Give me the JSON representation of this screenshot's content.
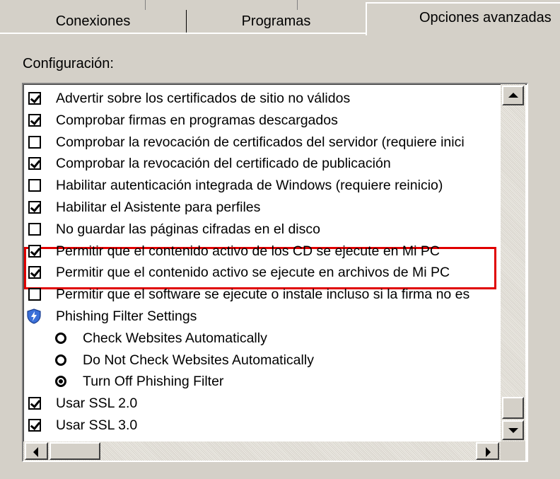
{
  "tabs": [
    {
      "label": "Conexiones",
      "active": false
    },
    {
      "label": "Programas",
      "active": false
    },
    {
      "label": "Opciones avanzadas",
      "active": true
    }
  ],
  "config_label": "Configuración:",
  "items": [
    {
      "type": "checkbox",
      "checked": true,
      "label": "Advertir sobre los certificados de sitio no válidos"
    },
    {
      "type": "checkbox",
      "checked": true,
      "label": "Comprobar firmas en programas descargados"
    },
    {
      "type": "checkbox",
      "checked": false,
      "label": "Comprobar la revocación de certificados del servidor (requiere inici"
    },
    {
      "type": "checkbox",
      "checked": true,
      "label": "Comprobar la revocación del certificado de publicación"
    },
    {
      "type": "checkbox",
      "checked": false,
      "label": "Habilitar autenticación integrada de Windows (requiere reinicio)"
    },
    {
      "type": "checkbox",
      "checked": true,
      "label": "Habilitar el Asistente para perfiles"
    },
    {
      "type": "checkbox",
      "checked": false,
      "label": "No guardar las páginas cifradas en el disco"
    },
    {
      "type": "checkbox",
      "checked": true,
      "label": "Permitir que el contenido activo de los CD se ejecute en Mi PC",
      "highlighted": true
    },
    {
      "type": "checkbox",
      "checked": true,
      "label": "Permitir que el contenido activo se ejecute en archivos de Mi PC",
      "highlighted": true
    },
    {
      "type": "checkbox",
      "checked": false,
      "label": "Permitir que el software se ejecute o instale incluso si la firma no es"
    },
    {
      "type": "group",
      "icon": "shield-icon",
      "label": "Phishing Filter Settings"
    },
    {
      "type": "radio",
      "checked": false,
      "label": "Check Websites Automatically"
    },
    {
      "type": "radio",
      "checked": false,
      "label": "Do Not Check Websites Automatically"
    },
    {
      "type": "radio",
      "checked": true,
      "label": "Turn Off Phishing Filter"
    },
    {
      "type": "checkbox",
      "checked": true,
      "label": "Usar SSL 2.0"
    },
    {
      "type": "checkbox",
      "checked": true,
      "label": "Usar SSL 3.0"
    }
  ],
  "highlight_color": "#e00000",
  "icons": {
    "scroll_up": "arrow-up-icon",
    "scroll_down": "arrow-down-icon",
    "scroll_left": "arrow-left-icon",
    "scroll_right": "arrow-right-icon"
  }
}
